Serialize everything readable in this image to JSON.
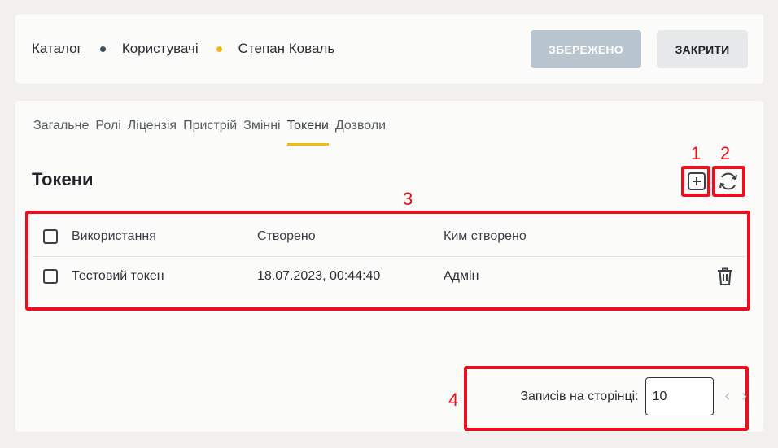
{
  "breadcrumb": {
    "items": [
      {
        "label": "Каталог"
      },
      {
        "label": "Користувачі"
      },
      {
        "label": "Степан Коваль"
      }
    ],
    "dot_colors": [
      "#3c4d5a",
      "#f2b90f"
    ]
  },
  "actions": {
    "saved_label": "ЗБЕРЕЖЕНО",
    "close_label": "ЗАКРИТИ"
  },
  "tabs": [
    {
      "label": "Загальне",
      "active": false
    },
    {
      "label": "Ролі",
      "active": false
    },
    {
      "label": "Ліцензія",
      "active": false
    },
    {
      "label": "Пристрій",
      "active": false
    },
    {
      "label": "Змінні",
      "active": false
    },
    {
      "label": "Токени",
      "active": true
    },
    {
      "label": "Дозволи",
      "active": false
    }
  ],
  "section": {
    "title": "Токени",
    "add_icon": "plus-square-icon",
    "refresh_icon": "refresh-icon"
  },
  "table": {
    "columns": [
      "Використання",
      "Створено",
      "Ким створено"
    ],
    "rows": [
      {
        "name": "Тестовий токен",
        "created": "18.07.2023, 00:44:40",
        "created_by": "Адмін"
      }
    ]
  },
  "pagination": {
    "label": "Записів на сторінці:",
    "value": "10",
    "prev_icon": "chevron-left-icon",
    "next_icon": "chevron-right-icon"
  },
  "annotations": [
    "1",
    "2",
    "3",
    "4"
  ],
  "colors": {
    "accent": "#f2b90f",
    "annotation_red": "#e8101e",
    "disabled_button": "#b9c5ce"
  }
}
